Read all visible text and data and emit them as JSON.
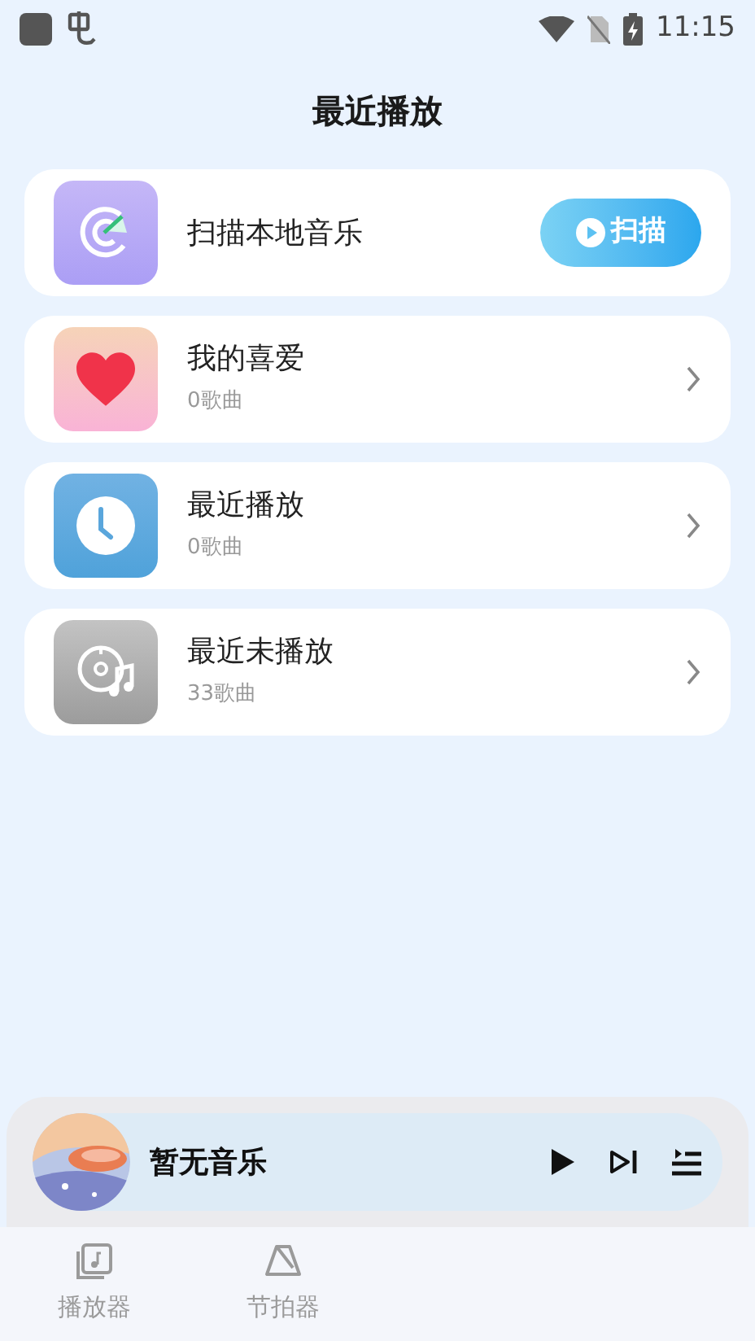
{
  "status_bar": {
    "time": "11:15"
  },
  "title": "最近播放",
  "scan_card": {
    "label": "扫描本地音乐",
    "button": "扫描"
  },
  "lists": [
    {
      "kind": "favorite",
      "title": "我的喜爱",
      "count": "0歌曲"
    },
    {
      "kind": "recent",
      "title": "最近播放",
      "count": "0歌曲"
    },
    {
      "kind": "unplayed",
      "title": "最近未播放",
      "count": "33歌曲"
    }
  ],
  "player": {
    "title": "暂无音乐"
  },
  "tabs": [
    {
      "kind": "player",
      "label": "播放器",
      "selected": false
    },
    {
      "kind": "metronome",
      "label": "节拍器",
      "selected": false
    }
  ]
}
